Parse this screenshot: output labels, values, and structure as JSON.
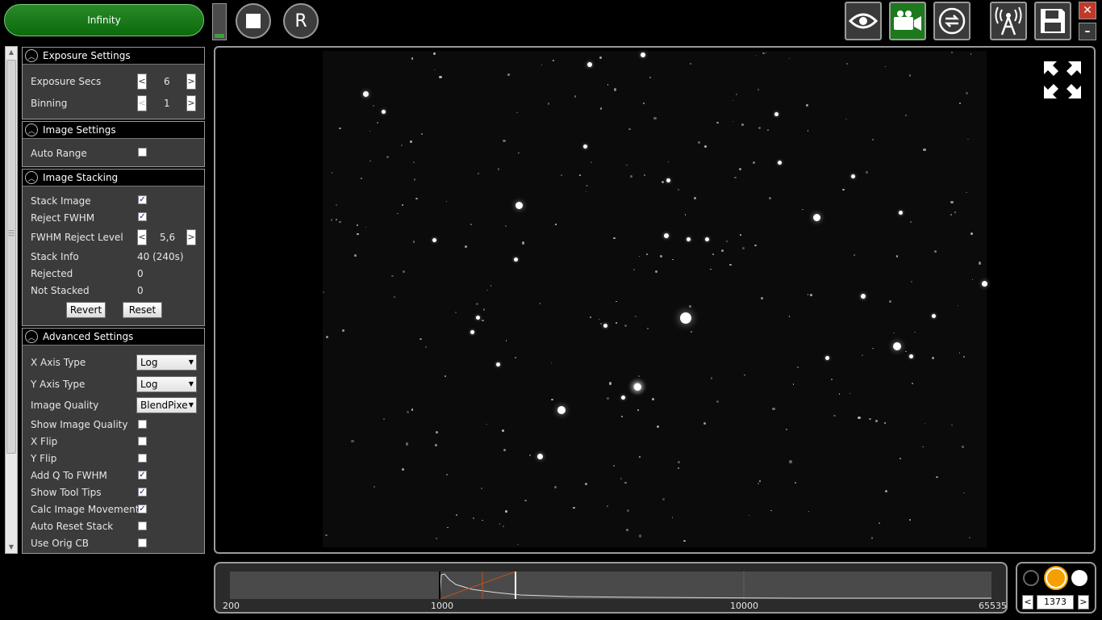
{
  "toolbar": {
    "infinity_label": "Infinity",
    "stop_icon": "stop-icon",
    "reset_label": "R",
    "progress_level": 0.12,
    "right_icons": [
      "eye-icon",
      "camera-icon",
      "refresh-icon",
      "antenna-icon",
      "save-icon"
    ],
    "close_label": "✕",
    "minimize_label": "–"
  },
  "exposure": {
    "title": "Exposure Settings",
    "exposure_secs_label": "Exposure Secs",
    "exposure_secs_value": "6",
    "binning_label": "Binning",
    "binning_value": "1"
  },
  "image_settings": {
    "title": "Image Settings",
    "auto_range_label": "Auto Range",
    "auto_range_checked": false
  },
  "stacking": {
    "title": "Image Stacking",
    "stack_image_label": "Stack Image",
    "stack_image_checked": true,
    "reject_fwhm_label": "Reject FWHM",
    "reject_fwhm_checked": true,
    "fwhm_reject_level_label": "FWHM Reject Level",
    "fwhm_reject_level_value": "5,6",
    "stack_info_label": "Stack Info",
    "stack_info_value": "40 (240s)",
    "rejected_label": "Rejected",
    "rejected_value": "0",
    "not_stacked_label": "Not Stacked",
    "not_stacked_value": "0",
    "revert_label": "Revert",
    "reset_label": "Reset"
  },
  "advanced": {
    "title": "Advanced Settings",
    "x_axis_type_label": "X Axis Type",
    "x_axis_type_value": "Log",
    "y_axis_type_label": "Y Axis Type",
    "y_axis_type_value": "Log",
    "image_quality_label": "Image Quality",
    "image_quality_value": "BlendPixe",
    "show_image_quality_label": "Show Image Quality",
    "show_image_quality_checked": false,
    "x_flip_label": "X Flip",
    "x_flip_checked": false,
    "y_flip_label": "Y Flip",
    "y_flip_checked": false,
    "add_q_label": "Add Q To FWHM",
    "add_q_checked": true,
    "show_tool_tips_label": "Show Tool Tips",
    "show_tool_tips_checked": true,
    "calc_movement_label": "Calc Image Movement",
    "calc_movement_checked": true,
    "auto_reset_label": "Auto Reset Stack",
    "auto_reset_checked": false,
    "use_orig_cb_label": "Use Orig CB",
    "use_orig_cb_checked": false
  },
  "viewer": {
    "expand_icon": "fullscreen-icon"
  },
  "histogram": {
    "tick_labels": [
      "200",
      "1000",
      "10000",
      "65535"
    ],
    "black_point_value": 1000,
    "white_point_value": 1373
  },
  "color_points": {
    "colors": {
      "black": "#000000",
      "mid": "#f5a000",
      "white": "#ffffff"
    },
    "prev_label": "<",
    "next_label": ">",
    "value": "1373"
  },
  "colors": {
    "accent_green": "#1c7a1c",
    "panel_bg": "#3b3b3b",
    "highlight_orange": "#f5a000"
  }
}
